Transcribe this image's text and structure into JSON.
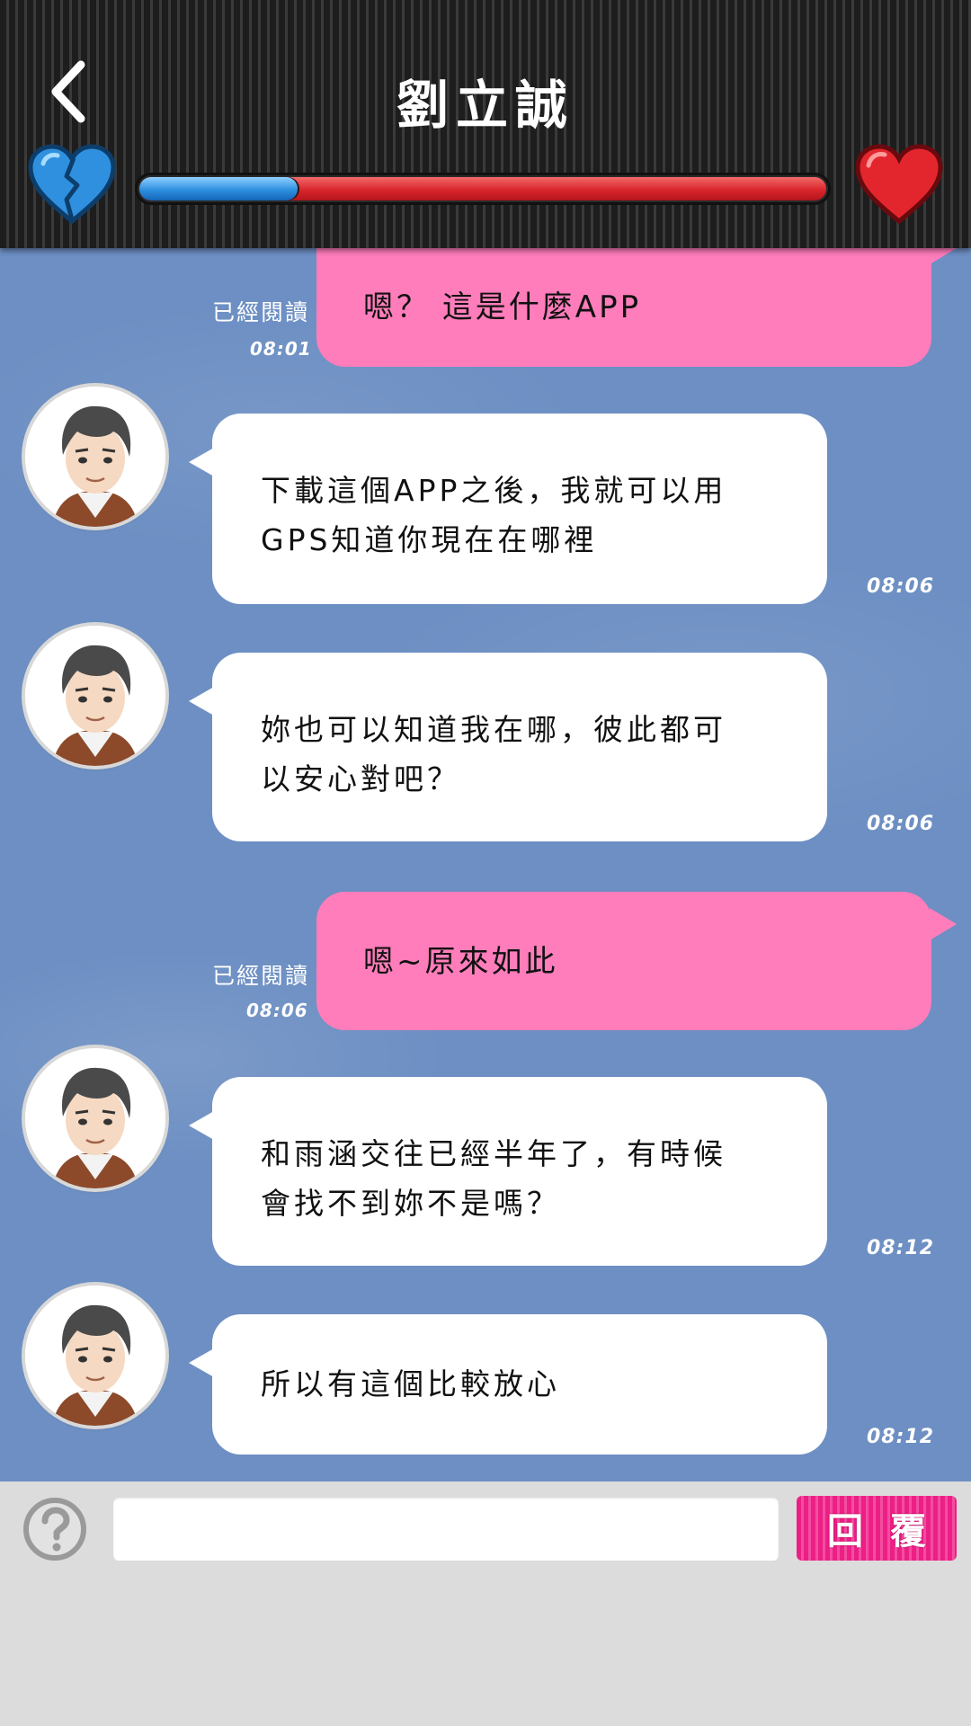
{
  "header": {
    "title": "劉立誠",
    "affection_level": 0.23,
    "colors": {
      "broken_heart": "#3aa0ea",
      "heart": "#e0272d",
      "meter_fill": "#2e8fe0",
      "meter_track": "#d9262c"
    }
  },
  "messages": [
    {
      "type": "outgoing",
      "text": "嗯？ 這是什麼APP",
      "status": "已經閱讀",
      "time": "08:01"
    },
    {
      "type": "incoming",
      "lines": [
        "下載這個APP之後，我就可以用",
        "GPS知道你現在在哪裡"
      ],
      "time": "08:06"
    },
    {
      "type": "incoming",
      "lines": [
        "妳也可以知道我在哪，彼此都可",
        "以安心對吧？"
      ],
      "time": "08:06"
    },
    {
      "type": "outgoing",
      "text": "嗯~原來如此",
      "status": "已經閱讀",
      "time": "08:06"
    },
    {
      "type": "incoming",
      "lines": [
        "和雨涵交往已經半年了，有時候",
        "會找不到妳不是嗎？"
      ],
      "time": "08:12"
    },
    {
      "type": "incoming",
      "lines": [
        "所以有這個比較放心"
      ],
      "time": "08:12"
    }
  ],
  "input": {
    "placeholder": "",
    "value": "",
    "reply_label": "回覆"
  },
  "icons": {
    "back": "chevron-left-icon",
    "help": "question-circle-icon"
  }
}
